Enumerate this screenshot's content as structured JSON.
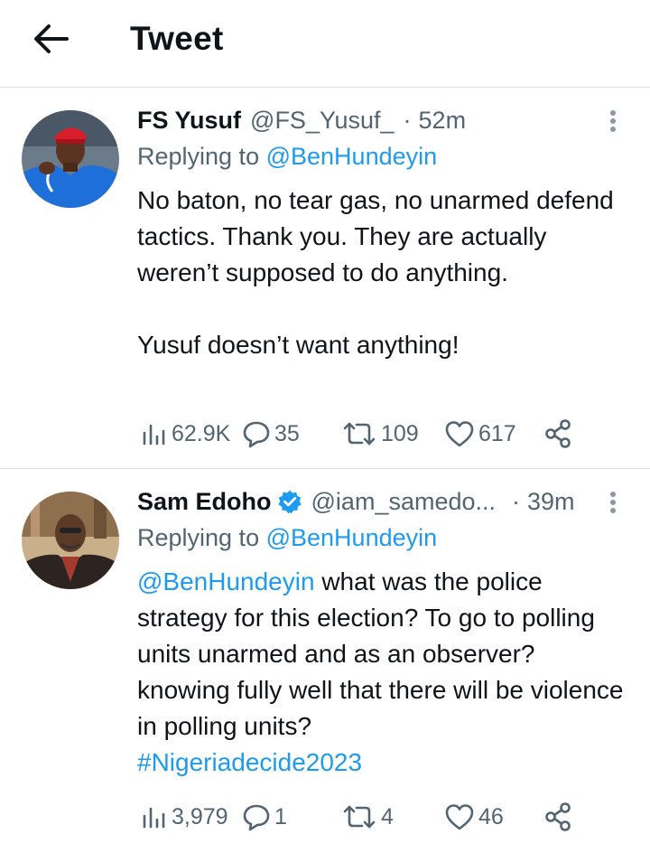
{
  "header": {
    "title": "Tweet",
    "back_icon": "arrow-left-icon"
  },
  "colors": {
    "link": "#1d9bf0",
    "secondary": "#536471",
    "text": "#0f1419",
    "divider": "#dcdfe2"
  },
  "tweets": [
    {
      "name": "FS Yusuf",
      "handle": "@FS_Yusuf_",
      "separator": "·",
      "time": "52m",
      "verified": false,
      "replying_prefix": "Replying to",
      "replying_to": "@BenHundeyin",
      "body_lines": [
        "No baton, no tear gas, no unarmed defend tactics. Thank you. They are actually weren’t supposed to do anything.",
        "Yusuf doesn’t want anything!"
      ],
      "stats": {
        "views": "62.9K",
        "replies": "35",
        "retweets": "109",
        "likes": "617"
      }
    },
    {
      "name": "Sam Edoho",
      "handle": "@iam_samedo...",
      "separator": "·",
      "time": "39m",
      "verified": true,
      "replying_prefix": "Replying to",
      "replying_to": "@BenHundeyin",
      "body_mention": "@BenHundeyin",
      "body_text": " what was the police strategy for this election? To go to polling units unarmed and as an observer? knowing fully well that there will be violence in polling units?",
      "hashtag": "#Nigeriadecide2023",
      "stats": {
        "views": "3,979",
        "replies": "1",
        "retweets": "4",
        "likes": "46"
      }
    }
  ]
}
